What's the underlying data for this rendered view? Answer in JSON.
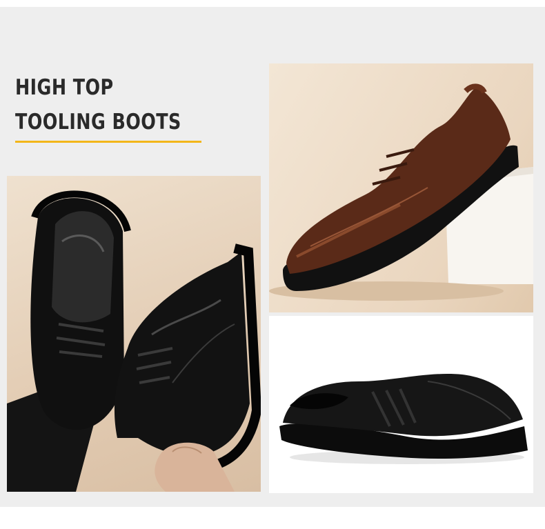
{
  "headline": {
    "line1": "HIGH TOP",
    "line2": "TOOLING BOOTS"
  },
  "colors": {
    "accent_rule": "#f3b619",
    "background": "#eeeeee",
    "text": "#2a2a2a"
  },
  "photos": [
    {
      "name": "pair-of-black-shoes-worn-and-held-photo"
    },
    {
      "name": "brown-leather-shoe-on-pedestal-photo"
    },
    {
      "name": "black-leather-shoe-side-view-photo"
    }
  ]
}
